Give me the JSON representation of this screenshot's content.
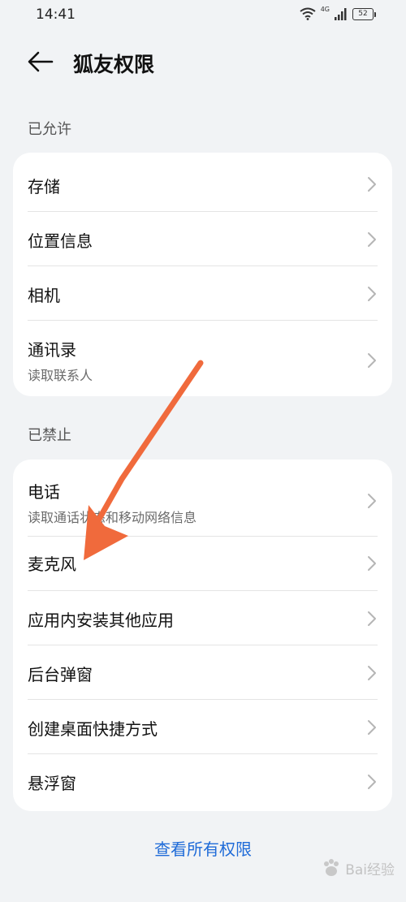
{
  "status_bar": {
    "time": "14:41",
    "network": "4G",
    "battery": "52",
    "icons": [
      "wifi-icon",
      "signal-icon",
      "battery-icon"
    ]
  },
  "header": {
    "title": "狐友权限",
    "back_icon": "back-arrow-icon"
  },
  "allowed": {
    "label": "已允许",
    "items": [
      {
        "title": "存储",
        "subtitle": ""
      },
      {
        "title": "位置信息",
        "subtitle": ""
      },
      {
        "title": "相机",
        "subtitle": ""
      },
      {
        "title": "通讯录",
        "subtitle": "读取联系人"
      }
    ]
  },
  "denied": {
    "label": "已禁止",
    "items": [
      {
        "title": "电话",
        "subtitle": "读取通话状态和移动网络信息"
      },
      {
        "title": "麦克风",
        "subtitle": ""
      },
      {
        "title": "应用内安装其他应用",
        "subtitle": ""
      },
      {
        "title": "后台弹窗",
        "subtitle": ""
      },
      {
        "title": "创建桌面快捷方式",
        "subtitle": ""
      },
      {
        "title": "悬浮窗",
        "subtitle": ""
      }
    ]
  },
  "footer": {
    "view_all": "查看所有权限"
  },
  "watermark": {
    "text": "Bai经验"
  },
  "colors": {
    "accent": "#1f6bd8",
    "annotation_arrow": "#f06a3c",
    "background": "#f1f3f5"
  }
}
